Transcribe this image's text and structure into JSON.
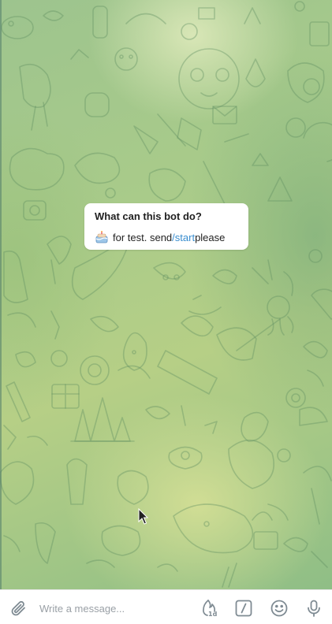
{
  "bot_info": {
    "title": "What can this bot do?",
    "description_prefix": "for test. send ",
    "command": "/start",
    "description_suffix": " please",
    "emoji_icon": "birthday-cake-icon"
  },
  "composer": {
    "placeholder": "Write a message...",
    "attach_icon": "paperclip-icon",
    "timer_icon": "auto-delete-timer-icon",
    "timer_label": "1d",
    "commands_icon": "slash-command-icon",
    "emoji_icon": "smile-icon",
    "mic_icon": "microphone-icon"
  },
  "colors": {
    "link": "#3a8ecf",
    "icon_gray": "#7f8b93",
    "card_bg": "#ffffff"
  }
}
